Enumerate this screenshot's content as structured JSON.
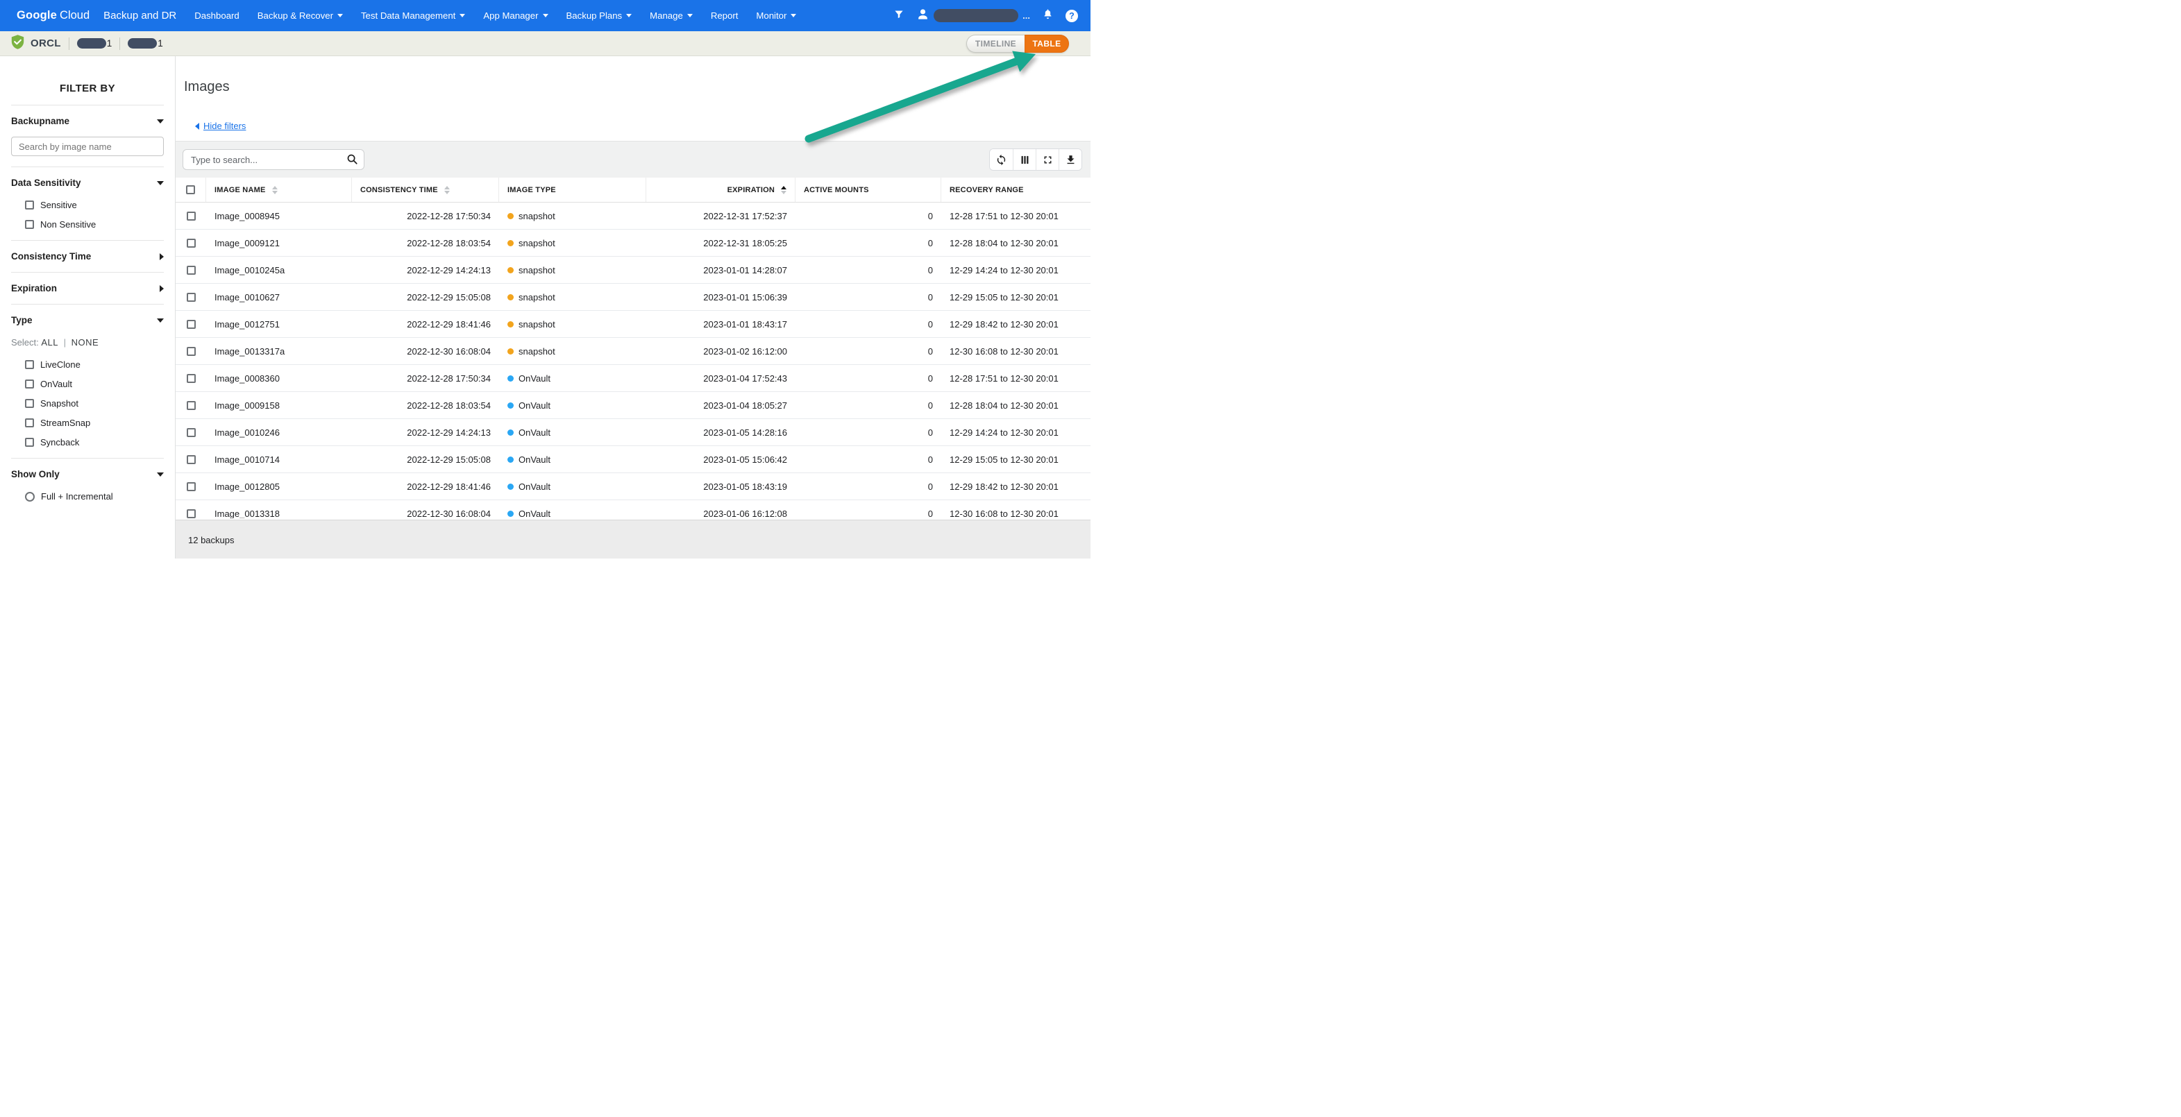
{
  "nav": {
    "logo": {
      "part1": "Google",
      "part2": "Cloud"
    },
    "product": "Backup and DR",
    "items": [
      {
        "label": "Dashboard",
        "caret": false
      },
      {
        "label": "Backup & Recover",
        "caret": true
      },
      {
        "label": "Test Data Management",
        "caret": true
      },
      {
        "label": "App Manager",
        "caret": true
      },
      {
        "label": "Backup Plans",
        "caret": true
      },
      {
        "label": "Manage",
        "caret": true
      },
      {
        "label": "Report",
        "caret": false
      },
      {
        "label": "Monitor",
        "caret": true
      }
    ],
    "right": {
      "user_truncated": "..."
    }
  },
  "statusbar": {
    "app_name": "ORCL",
    "redacted_items": [
      {
        "suffix": "1"
      },
      {
        "suffix": "1"
      }
    ],
    "view_toggle": {
      "timeline_label": "TIMELINE",
      "table_label": "TABLE",
      "active": "TABLE"
    }
  },
  "sidebar": {
    "title": "FILTER BY",
    "backupname": {
      "label": "Backupname",
      "expanded": true,
      "placeholder": "Search by image name"
    },
    "data_sensitivity": {
      "label": "Data Sensitivity",
      "expanded": true,
      "options": [
        "Sensitive",
        "Non Sensitive"
      ]
    },
    "consistency_time": {
      "label": "Consistency Time",
      "expanded": false
    },
    "expiration": {
      "label": "Expiration",
      "expanded": false
    },
    "type": {
      "label": "Type",
      "expanded": true,
      "select_label": "Select:",
      "select_all": "ALL",
      "select_sep": "|",
      "select_none": "NONE",
      "options": [
        "LiveClone",
        "OnVault",
        "Snapshot",
        "StreamSnap",
        "Syncback"
      ]
    },
    "show_only": {
      "label": "Show Only",
      "expanded": true,
      "option": "Full + Incremental"
    }
  },
  "main": {
    "title": "Images",
    "hide_filters_label": "Hide filters",
    "search_placeholder": "Type to search..."
  },
  "table": {
    "columns": [
      {
        "key": "select",
        "label": "",
        "sort": null
      },
      {
        "key": "image_name",
        "label": "IMAGE NAME",
        "sort": "both"
      },
      {
        "key": "consistency_time",
        "label": "CONSISTENCY TIME",
        "sort": "both"
      },
      {
        "key": "image_type",
        "label": "IMAGE TYPE",
        "sort": null
      },
      {
        "key": "expiration",
        "label": "EXPIRATION",
        "sort": "asc"
      },
      {
        "key": "active_mounts",
        "label": "ACTIVE MOUNTS",
        "sort": null
      },
      {
        "key": "recovery_range",
        "label": "RECOVERY RANGE",
        "sort": null
      }
    ],
    "rows": [
      {
        "image_name": "Image_0008945",
        "consistency_time": "2022-12-28 17:50:34",
        "image_type": "snapshot",
        "expiration": "2022-12-31 17:52:37",
        "active_mounts": "0",
        "recovery_range": "12-28 17:51 to 12-30 20:01"
      },
      {
        "image_name": "Image_0009121",
        "consistency_time": "2022-12-28 18:03:54",
        "image_type": "snapshot",
        "expiration": "2022-12-31 18:05:25",
        "active_mounts": "0",
        "recovery_range": "12-28 18:04 to 12-30 20:01"
      },
      {
        "image_name": "Image_0010245a",
        "consistency_time": "2022-12-29 14:24:13",
        "image_type": "snapshot",
        "expiration": "2023-01-01 14:28:07",
        "active_mounts": "0",
        "recovery_range": "12-29 14:24 to 12-30 20:01"
      },
      {
        "image_name": "Image_0010627",
        "consistency_time": "2022-12-29 15:05:08",
        "image_type": "snapshot",
        "expiration": "2023-01-01 15:06:39",
        "active_mounts": "0",
        "recovery_range": "12-29 15:05 to 12-30 20:01"
      },
      {
        "image_name": "Image_0012751",
        "consistency_time": "2022-12-29 18:41:46",
        "image_type": "snapshot",
        "expiration": "2023-01-01 18:43:17",
        "active_mounts": "0",
        "recovery_range": "12-29 18:42 to 12-30 20:01"
      },
      {
        "image_name": "Image_0013317a",
        "consistency_time": "2022-12-30 16:08:04",
        "image_type": "snapshot",
        "expiration": "2023-01-02 16:12:00",
        "active_mounts": "0",
        "recovery_range": "12-30 16:08 to 12-30 20:01"
      },
      {
        "image_name": "Image_0008360",
        "consistency_time": "2022-12-28 17:50:34",
        "image_type": "OnVault",
        "expiration": "2023-01-04 17:52:43",
        "active_mounts": "0",
        "recovery_range": "12-28 17:51 to 12-30 20:01"
      },
      {
        "image_name": "Image_0009158",
        "consistency_time": "2022-12-28 18:03:54",
        "image_type": "OnVault",
        "expiration": "2023-01-04 18:05:27",
        "active_mounts": "0",
        "recovery_range": "12-28 18:04 to 12-30 20:01"
      },
      {
        "image_name": "Image_0010246",
        "consistency_time": "2022-12-29 14:24:13",
        "image_type": "OnVault",
        "expiration": "2023-01-05 14:28:16",
        "active_mounts": "0",
        "recovery_range": "12-29 14:24 to 12-30 20:01"
      },
      {
        "image_name": "Image_0010714",
        "consistency_time": "2022-12-29 15:05:08",
        "image_type": "OnVault",
        "expiration": "2023-01-05 15:06:42",
        "active_mounts": "0",
        "recovery_range": "12-29 15:05 to 12-30 20:01"
      },
      {
        "image_name": "Image_0012805",
        "consistency_time": "2022-12-29 18:41:46",
        "image_type": "OnVault",
        "expiration": "2023-01-05 18:43:19",
        "active_mounts": "0",
        "recovery_range": "12-29 18:42 to 12-30 20:01"
      },
      {
        "image_name": "Image_0013318",
        "consistency_time": "2022-12-30 16:08:04",
        "image_type": "OnVault",
        "expiration": "2023-01-06 16:12:08",
        "active_mounts": "0",
        "recovery_range": "12-30 16:08 to 12-30 20:01"
      }
    ]
  },
  "footer": {
    "count_label": "12 backups"
  },
  "colors": {
    "nav_blue": "#1A73E8",
    "statusbar_bg": "#EDEEE6",
    "table_button_orange": "#ED7412",
    "timeline_button_text": "#8F9397",
    "arrow_teal": "#18A78F",
    "shield_green": "#7CB342",
    "redaction": "#414D63",
    "link_blue": "#1A73E8",
    "type_dots": {
      "snapshot": "#F2A41D",
      "OnVault": "#2AA7F4"
    }
  }
}
